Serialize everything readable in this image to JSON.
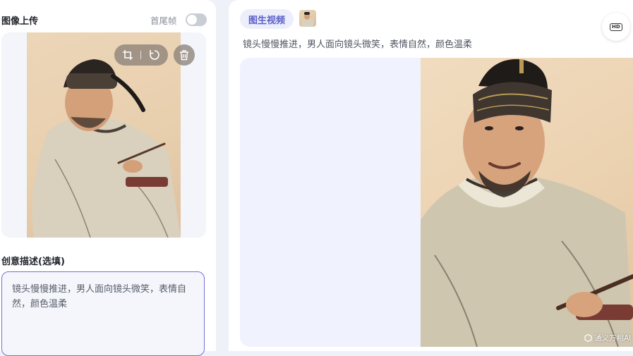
{
  "upload": {
    "title": "图像上传",
    "toggle_label": "首尾帧",
    "toggle_on": false
  },
  "description": {
    "title": "创意描述(选填)",
    "value": "镜头慢慢推进，男人面向镜头微笑，表情自然，颜色温柔"
  },
  "result": {
    "tag": "图生视频",
    "prompt": "镜头慢慢推进，男人面向镜头微笑，表情自然，颜色温柔",
    "hd_label": "HD",
    "watermark": "通义万相AI"
  },
  "colors": {
    "accent": "#5b5fc7",
    "border_active": "#6e73d6",
    "panel_bg": "#f3f5fb"
  },
  "icons": [
    "crop-icon",
    "rotate-icon",
    "trash-icon",
    "hd-icon",
    "watermark-logo-icon"
  ]
}
